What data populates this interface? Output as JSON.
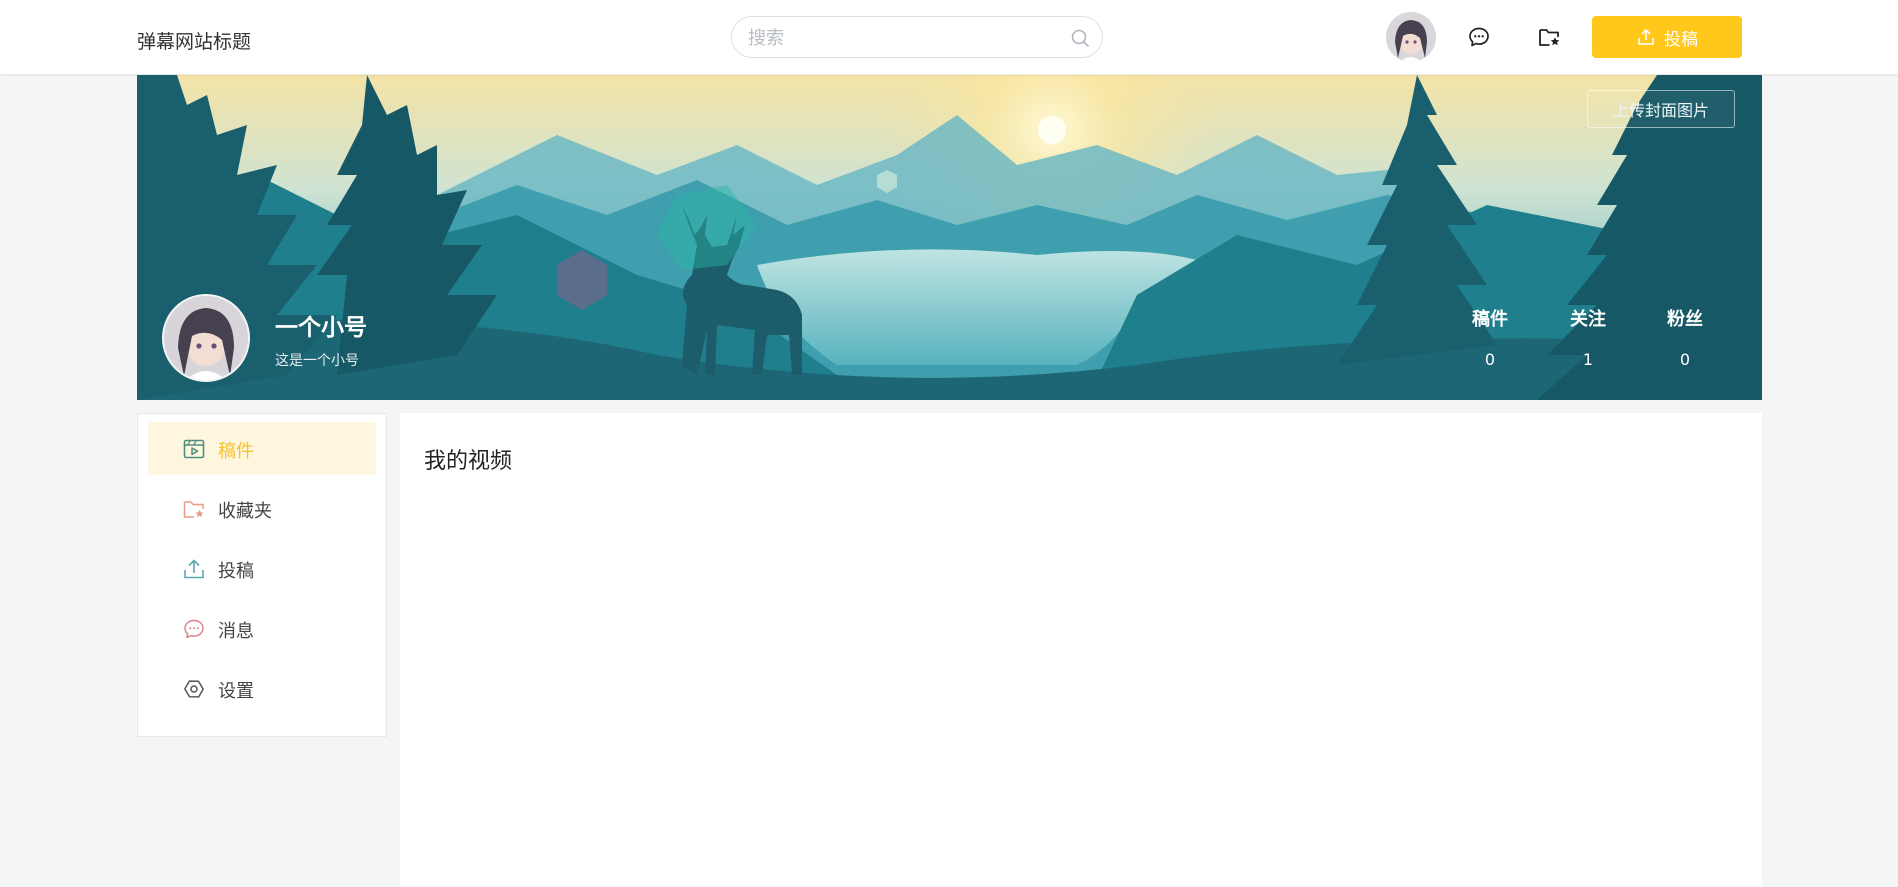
{
  "header": {
    "site_title": "弹幕网站标题",
    "search_placeholder": "搜索",
    "upload_label": "投稿"
  },
  "banner": {
    "upload_cover_label": "上传封面图片",
    "profile": {
      "name": "一个小号",
      "bio": "这是一个小号"
    },
    "stats": [
      {
        "label": "稿件",
        "value": "0"
      },
      {
        "label": "关注",
        "value": "1"
      },
      {
        "label": "粉丝",
        "value": "0"
      }
    ]
  },
  "sidebar": {
    "items": [
      {
        "label": "稿件",
        "icon": "video-file-icon",
        "active": true
      },
      {
        "label": "收藏夹",
        "icon": "folder-star-icon",
        "active": false
      },
      {
        "label": "投稿",
        "icon": "upload-icon",
        "active": false
      },
      {
        "label": "消息",
        "icon": "chat-bubble-icon",
        "active": false
      },
      {
        "label": "设置",
        "icon": "hexagon-settings-icon",
        "active": false
      }
    ]
  },
  "main": {
    "title": "我的视频"
  },
  "colors": {
    "accent": "#ffc81a",
    "active_bg": "#fff6df",
    "active_text": "#f5c22b"
  }
}
